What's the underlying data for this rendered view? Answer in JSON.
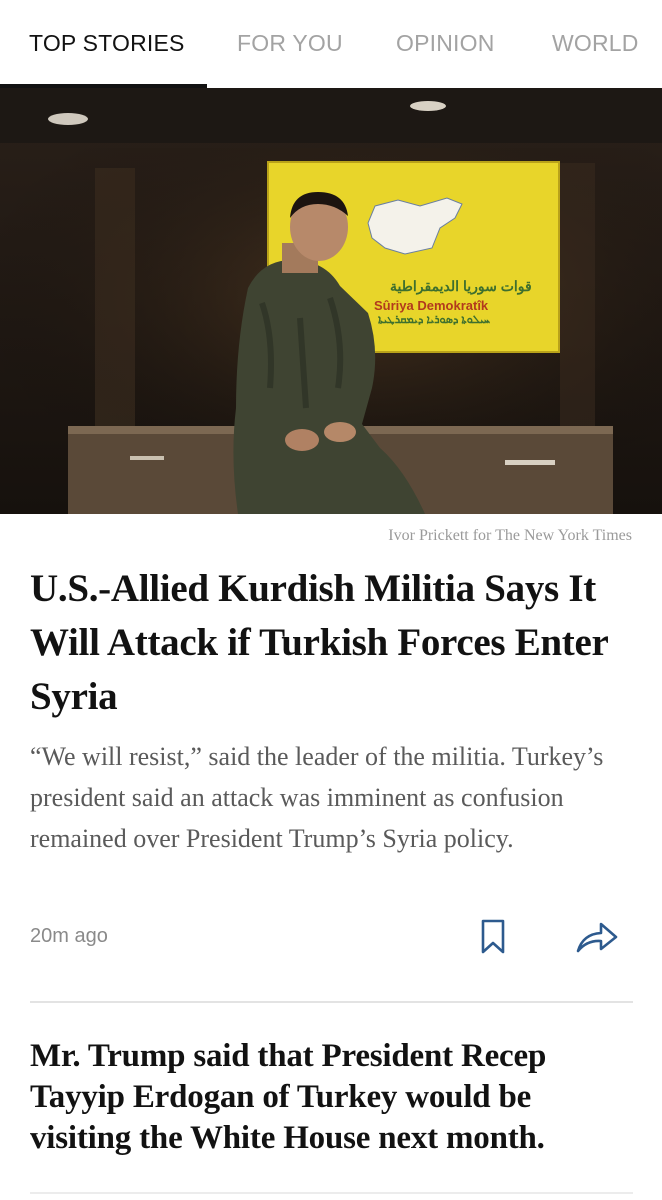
{
  "tabs": [
    {
      "label": "TOP STORIES",
      "active": true
    },
    {
      "label": "FOR YOU",
      "active": false
    },
    {
      "label": "OPINION",
      "active": false
    },
    {
      "label": "WORLD",
      "active": false
    }
  ],
  "hero": {
    "flag_text_arabic": "قوات سوريا الديمقراطية",
    "flag_text_latin": "Sûriya Demokratîk",
    "flag_text_syriac": "ܚܝܠܘܬܐ ܕܣܘܪܝܐ ܕܝܡܩܪܛܝܬܐ"
  },
  "article": {
    "photo_credit": "Ivor Prickett for The New York Times",
    "headline": "U.S.-Allied Kurdish Militia Says It Will Attack if Turkish Forces Enter Syria",
    "summary": "“We will resist,” said the leader of the militia. Turkey’s president said an attack was imminent as confusion remained over President Trump’s Syria policy.",
    "timestamp": "20m ago",
    "bookmark_icon": "bookmark-icon",
    "share_icon": "share-icon"
  },
  "next_story": {
    "headline": "Mr. Trump said that President Recep Tayyip Erdogan of Turkey would be visiting the White House next month."
  },
  "colors": {
    "text_primary": "#121212",
    "tab_inactive": "#a3a3a3",
    "summary_text": "#5a5a5a",
    "flag_yellow": "#e8d52a"
  }
}
